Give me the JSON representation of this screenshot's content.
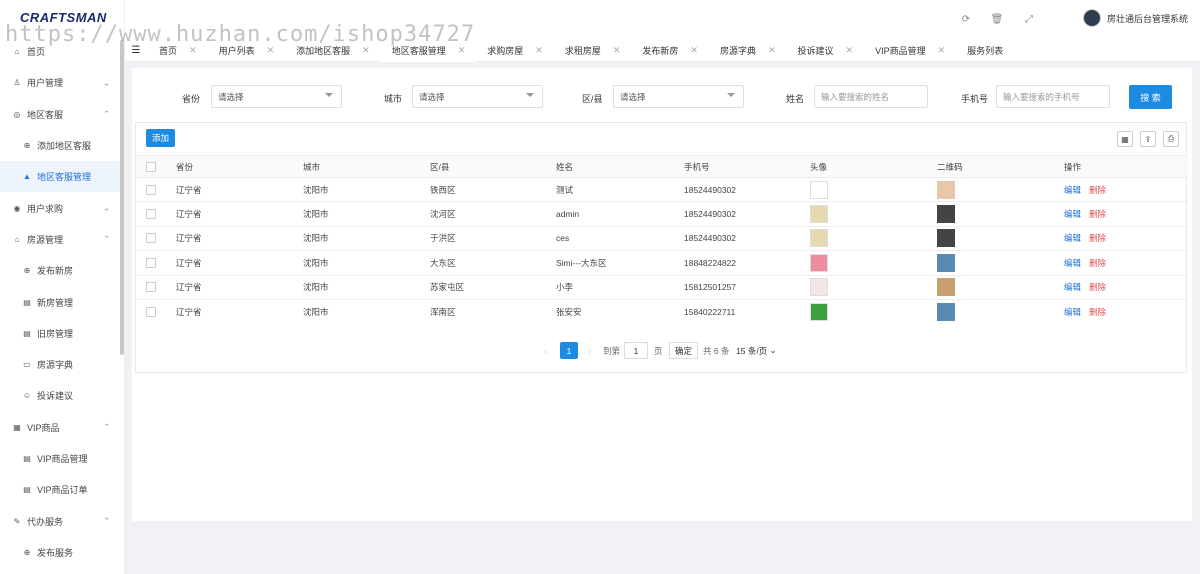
{
  "app": {
    "logo": "CRAFTSMAN",
    "user_name": "房壮通后台管理系统"
  },
  "watermark": "https://www.huzhan.com/ishop34727",
  "sidebar": {
    "items": [
      {
        "label": "首页",
        "icon": "home-icon",
        "sub": false
      },
      {
        "label": "用户管理",
        "icon": "user-icon",
        "sub": false,
        "caret": "down"
      },
      {
        "label": "地区客服",
        "icon": "service-icon",
        "sub": false,
        "caret": "up"
      },
      {
        "label": "添加地区客服",
        "icon": "plus-circle-icon",
        "sub": true
      },
      {
        "label": "地区客服管理",
        "icon": "person-icon",
        "sub": true,
        "active": true
      },
      {
        "label": "用户求购",
        "icon": "buy-icon",
        "sub": false,
        "caret": "down"
      },
      {
        "label": "房源管理",
        "icon": "house-icon",
        "sub": false,
        "caret": "up"
      },
      {
        "label": "发布新房",
        "icon": "plus-circle-icon",
        "sub": true
      },
      {
        "label": "新房管理",
        "icon": "list-icon",
        "sub": true
      },
      {
        "label": "旧房管理",
        "icon": "list-icon",
        "sub": true
      },
      {
        "label": "房源字典",
        "icon": "book-icon",
        "sub": true
      },
      {
        "label": "投诉建议",
        "icon": "smile-icon",
        "sub": true
      },
      {
        "label": "VIP商品",
        "icon": "gift-icon",
        "sub": false,
        "caret": "up"
      },
      {
        "label": "VIP商品管理",
        "icon": "list-icon",
        "sub": true
      },
      {
        "label": "VIP商品订单",
        "icon": "list-icon",
        "sub": true
      },
      {
        "label": "代办服务",
        "icon": "edit-icon",
        "sub": false,
        "caret": "up"
      },
      {
        "label": "发布服务",
        "icon": "plus-circle-icon",
        "sub": true
      }
    ]
  },
  "tabs": [
    {
      "label": "首页"
    },
    {
      "label": "用户列表"
    },
    {
      "label": "添加地区客服"
    },
    {
      "label": "地区客服管理",
      "active": true
    },
    {
      "label": "求购房屋"
    },
    {
      "label": "求租房屋"
    },
    {
      "label": "发布新房"
    },
    {
      "label": "房源字典"
    },
    {
      "label": "投诉建议"
    },
    {
      "label": "VIP商品管理"
    },
    {
      "label": "服务列表"
    }
  ],
  "filters": {
    "province_label": "省份",
    "province_value": "请选择",
    "city_label": "城市",
    "city_value": "请选择",
    "district_label": "区/县",
    "district_value": "请选择",
    "name_label": "姓名",
    "name_placeholder": "输入要搜索的姓名",
    "phone_label": "手机号",
    "phone_placeholder": "输入要搜索的手机号",
    "search_label": "搜 索"
  },
  "table": {
    "add_label": "添加",
    "columns": [
      "省份",
      "城市",
      "区/县",
      "姓名",
      "手机号",
      "头像",
      "二维码",
      "操作"
    ],
    "edit_label": "编辑",
    "delete_label": "删除",
    "rows": [
      {
        "province": "辽宁省",
        "city": "沈阳市",
        "district": "铁西区",
        "name": "测试",
        "phone": "18524490302"
      },
      {
        "province": "辽宁省",
        "city": "沈阳市",
        "district": "沈河区",
        "name": "admin",
        "phone": "18524490302"
      },
      {
        "province": "辽宁省",
        "city": "沈阳市",
        "district": "于洪区",
        "name": "ces",
        "phone": "18524490302"
      },
      {
        "province": "辽宁省",
        "city": "沈阳市",
        "district": "大东区",
        "name": "Simi---大东区",
        "phone": "18848224822"
      },
      {
        "province": "辽宁省",
        "city": "沈阳市",
        "district": "苏家屯区",
        "name": "小李",
        "phone": "15812501257"
      },
      {
        "province": "辽宁省",
        "city": "沈阳市",
        "district": "浑南区",
        "name": "张安安",
        "phone": "15840222711"
      }
    ]
  },
  "pager": {
    "current": "1",
    "goto_label": "到第",
    "goto_value": "1",
    "page_label": "页",
    "confirm_label": "确定",
    "total_label": "共 6 条",
    "page_size": "15 条/页"
  },
  "colors": {
    "accent": "#1d8ce0",
    "delete": "#e05050"
  }
}
